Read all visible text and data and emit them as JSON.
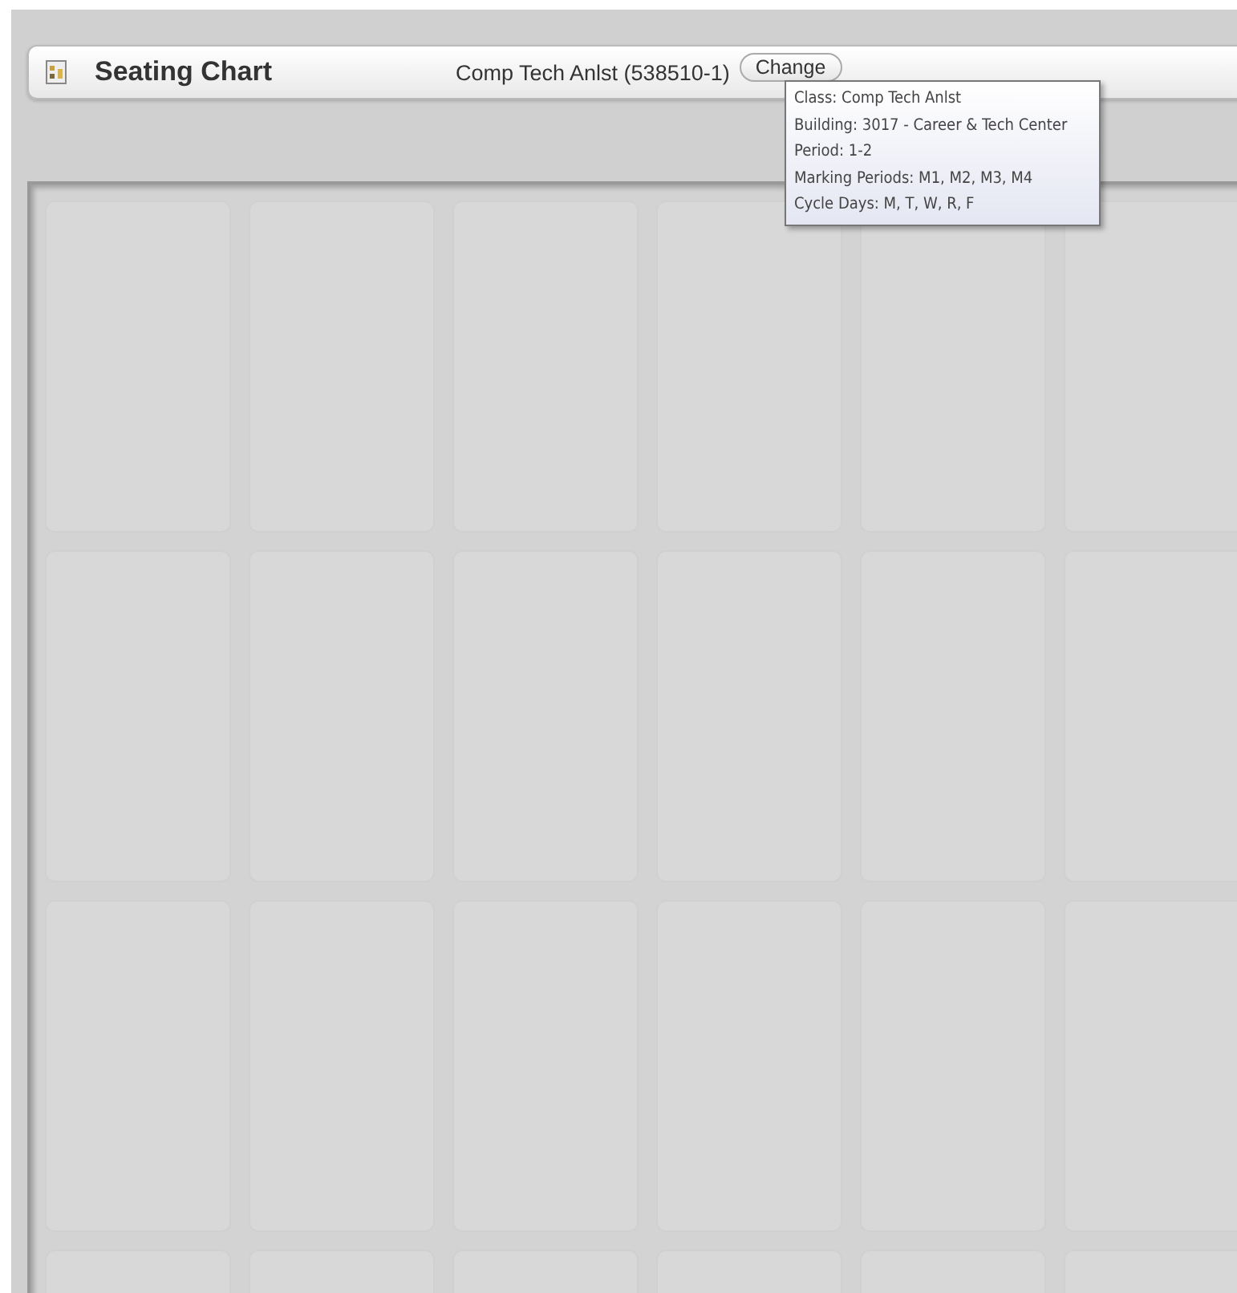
{
  "header": {
    "title": "Seating Chart",
    "class_name": "Comp Tech Anlst (538510-1)",
    "button": "Change"
  },
  "tooltip": {
    "lines": [
      "Class: Comp Tech Anlst",
      "Building: 3017 - Career & Tech Center",
      "Period: 1-2",
      "Marking Periods: M1, M2, M3, M4",
      "Cycle Days: M, T, W, R, F"
    ]
  }
}
